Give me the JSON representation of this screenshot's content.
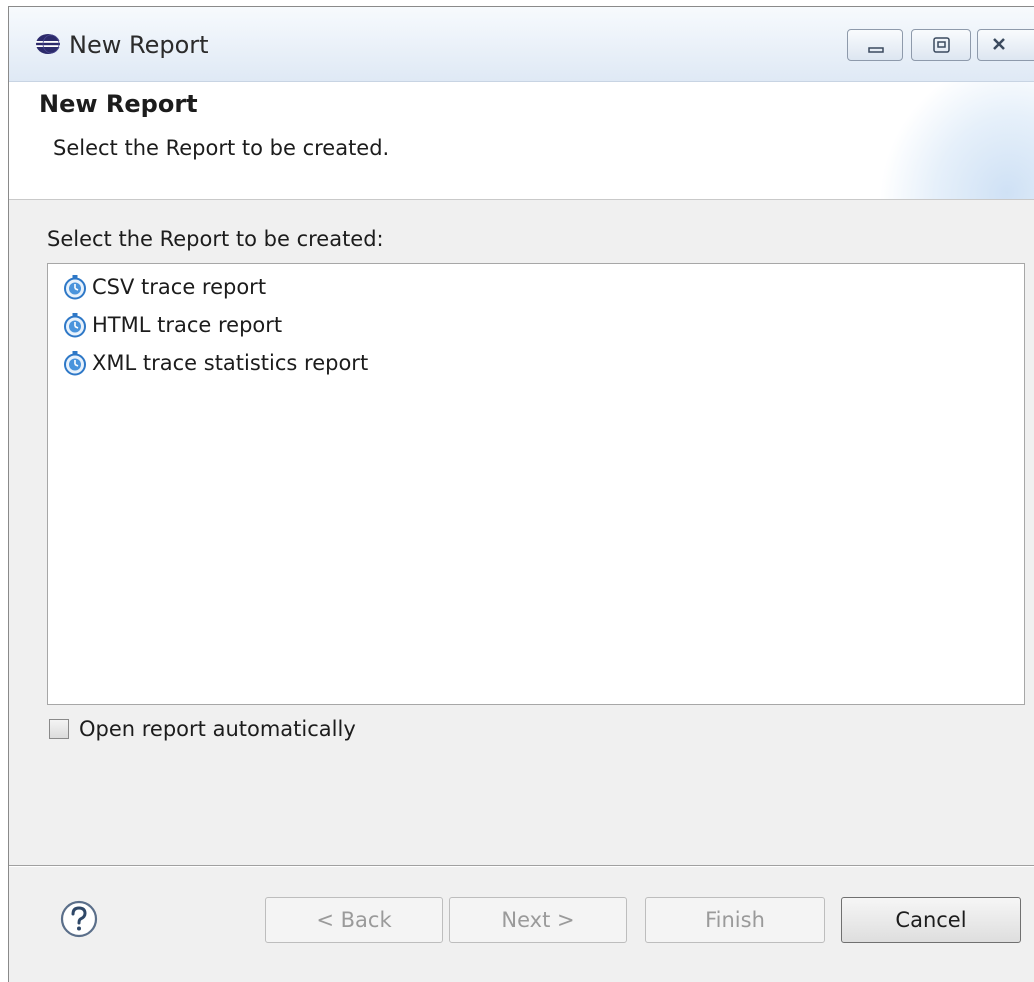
{
  "window": {
    "title": "New Report",
    "controls": {
      "minimize_icon": "minimize-icon",
      "maximize_icon": "maximize-icon",
      "close_icon": "close-icon"
    }
  },
  "banner": {
    "title": "New Report",
    "description": "Select the Report to be created."
  },
  "body": {
    "list_label": "Select the Report to be created:",
    "reports": [
      {
        "label": "CSV trace report",
        "icon": "stopwatch-icon"
      },
      {
        "label": "HTML trace report",
        "icon": "stopwatch-icon"
      },
      {
        "label": "XML trace statistics report",
        "icon": "stopwatch-icon"
      }
    ],
    "open_automatically": {
      "label": "Open report automatically",
      "checked": false
    }
  },
  "footer": {
    "help_icon": "help-icon",
    "back_label": "< Back",
    "next_label": "Next >",
    "finish_label": "Finish",
    "cancel_label": "Cancel"
  },
  "colors": {
    "titlebar_top": "#f7fafd",
    "titlebar_bottom": "#dfe9f5",
    "dialog_bg": "#f0f0f0",
    "icon_blue": "#2e78c7"
  }
}
